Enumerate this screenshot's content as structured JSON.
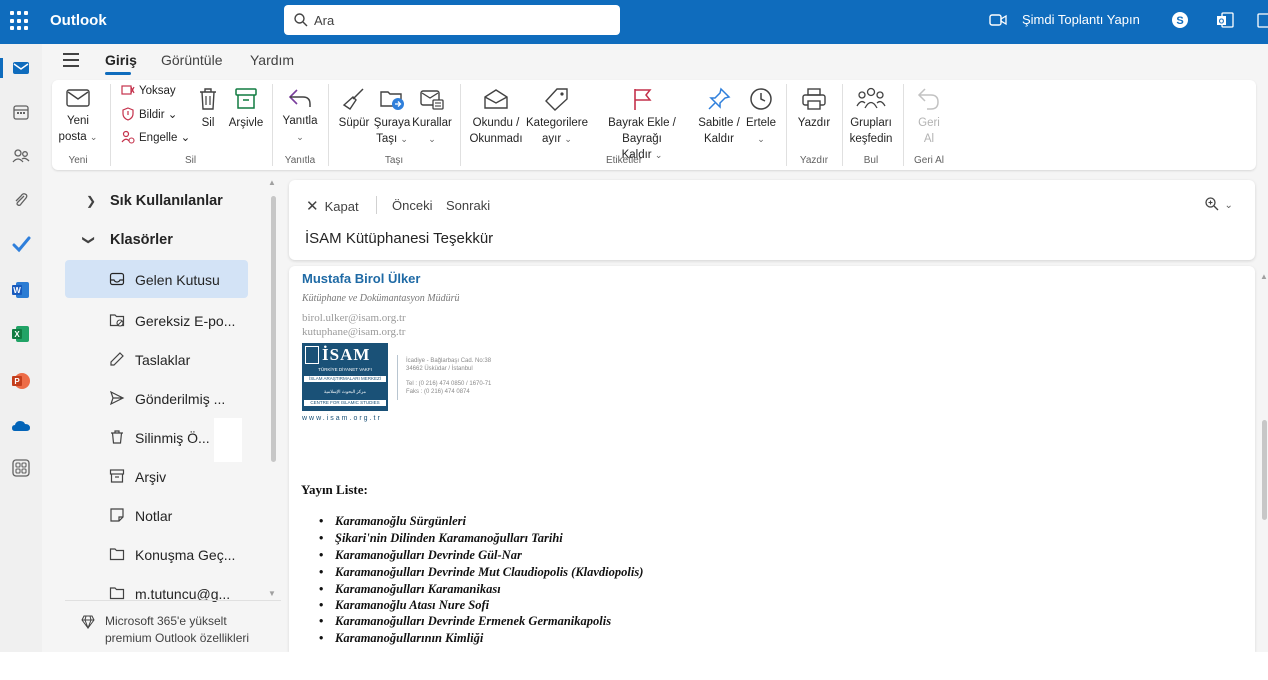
{
  "topbar": {
    "app_title": "Outlook",
    "search_placeholder": "Ara",
    "meet_now": "Şimdi Toplantı Yapın",
    "brand_color": "#0f6cbd"
  },
  "tabs": [
    {
      "label": "Giriş",
      "active": true
    },
    {
      "label": "Görüntüle",
      "active": false
    },
    {
      "label": "Yardım",
      "active": false
    }
  ],
  "ribbon": {
    "new_mail": {
      "line1": "Yeni",
      "line2": "posta"
    },
    "ignore": "Yoksay",
    "report": "Bildir",
    "block": "Engelle",
    "delete": "Sil",
    "archive": "Arşivle",
    "reply": "Yanıtla",
    "sweep": "Süpür",
    "move_to": {
      "line1": "Şuraya",
      "line2": "Taşı"
    },
    "rules": "Kurallar",
    "read_unread": {
      "line1": "Okundu /",
      "line2": "Okunmadı"
    },
    "categorize": {
      "line1": "Kategorilere",
      "line2": "ayır"
    },
    "flag": {
      "line1": "Bayrak Ekle / Bayrağı",
      "line2": "Kaldır"
    },
    "pin": {
      "line1": "Sabitle /",
      "line2": "Kaldır"
    },
    "snooze": "Ertele",
    "print": "Yazdır",
    "find_groups": {
      "line1": "Grupları",
      "line2": "keşfedin"
    },
    "undo": {
      "line1": "Geri",
      "line2": "Al"
    },
    "groups": {
      "new": "Yeni",
      "delete": "Sil",
      "respond": "Yanıtla",
      "move": "Taşı",
      "tags": "Etiketler",
      "print": "Yazdır",
      "find": "Bul",
      "undo": "Geri Al"
    }
  },
  "folders": {
    "favorites": "Sık Kullanılanlar",
    "folders_header": "Klasörler",
    "items": [
      {
        "label": "Gelen Kutusu",
        "icon": "inbox-icon",
        "selected": true
      },
      {
        "label": "Gereksiz E-po...",
        "icon": "junk-icon",
        "selected": false
      },
      {
        "label": "Taslaklar",
        "icon": "drafts-icon",
        "selected": false
      },
      {
        "label": "Gönderilmiş ...",
        "icon": "sent-icon",
        "selected": false
      },
      {
        "label": "Silinmiş Ö...",
        "icon": "trash-icon",
        "selected": false
      },
      {
        "label": "Arşiv",
        "icon": "archive-icon",
        "selected": false
      },
      {
        "label": "Notlar",
        "icon": "notes-icon",
        "selected": false
      },
      {
        "label": "Konuşma Geç...",
        "icon": "folder-icon",
        "selected": false
      },
      {
        "label": "m.tutuncu@g...",
        "icon": "folder-icon",
        "selected": false
      }
    ],
    "upsell": "Microsoft 365'e yükselt premium Outlook özellikleri"
  },
  "reading": {
    "close": "Kapat",
    "previous": "Önceki",
    "next": "Sonraki",
    "subject": "İSAM Kütüphanesi Teşekkür"
  },
  "signature": {
    "name": "Mustafa Birol Ülker",
    "title": "Kütüphane ve Dokümantasyon Müdürü",
    "email1": "birol.ulker@isam.org.tr",
    "email2": "kutuphane@isam.org.tr",
    "logo_text": "İSAM",
    "logo_line1": "TÜRKİYE DİYANET VAKFI",
    "logo_line2": "İSLAM ARAŞTIRMALARI MERKEZİ",
    "logo_line3": "مركز البحوث الإسلامية",
    "logo_line4": "CENTRE FOR ISLAMIC STUDIES",
    "logo_url": "www.isam.org.tr",
    "address1": "İcadiye - Bağlarbaşı Cad. No:38",
    "address2": "34662 Üsküdar / İstanbul",
    "phone": "Tel : (0 216) 474 0850 / 1670-71",
    "fax": "Faks : (0 216) 474 0874"
  },
  "body": {
    "list_title": "Yayın Liste:",
    "books": [
      "Karamanoğlu Sürgünleri",
      "Şikari'nin Dilinden Karamanoğulları Tarihi",
      "Karamanoğulları Devrinde Gül-Nar",
      "Karamanoğulları Devrinde Mut Claudiopolis (Klavdiopolis)",
      "Karamanoğulları Karamanikası",
      "Karamanoğlu Atası Nure Sofi",
      "Karamanoğulları Devrinde Ermenek Germanikapolis",
      "Karamanoğullarının Kimliği"
    ]
  }
}
